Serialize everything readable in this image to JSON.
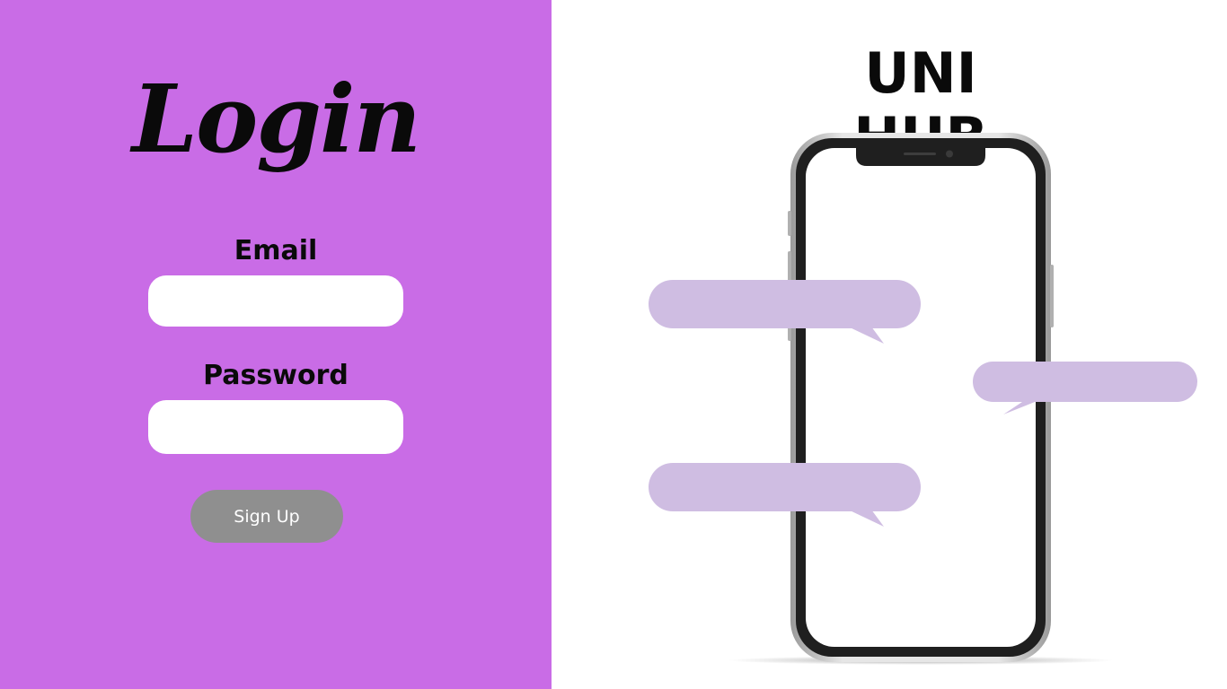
{
  "login": {
    "title": "Login",
    "email_label": "Email",
    "email_value": "",
    "password_label": "Password",
    "password_value": "",
    "signup_label": "Sign Up"
  },
  "brand": {
    "title": "UNI HUB"
  },
  "colors": {
    "panel_bg": "#c96ce6",
    "button_bg": "#8f8f8f",
    "bubble": "#cfbde2",
    "page_bg": "#ffffff"
  },
  "icons": {
    "phone": "smartphone-illustration",
    "bubble": "speech-bubble-icon"
  }
}
